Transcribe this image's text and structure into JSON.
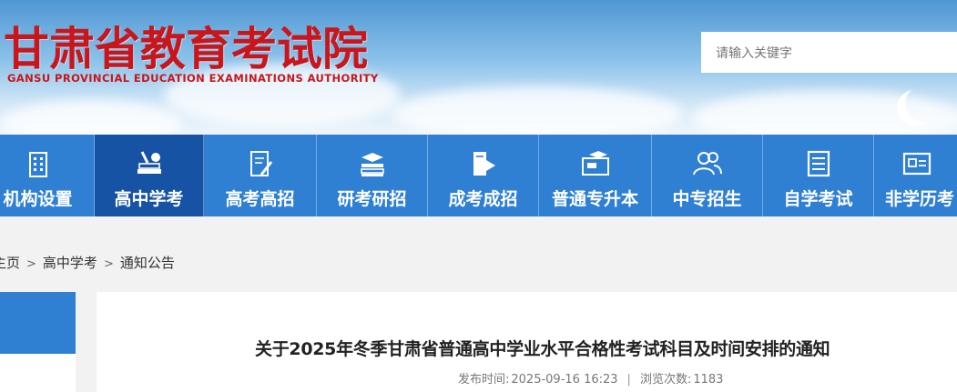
{
  "header": {
    "title_cn": "甘肃省教育考试院",
    "title_en": "GANSU PROVINCIAL EDUCATION EXAMINATIONS AUTHORITY",
    "brand_color": "#c8161d"
  },
  "search": {
    "placeholder": "请输入关键字"
  },
  "nav": {
    "items": [
      {
        "label": "机构设置",
        "icon": "building-icon"
      },
      {
        "label": "高中学考",
        "icon": "books-apple-icon",
        "active": true
      },
      {
        "label": "高考高招",
        "icon": "document-pen-icon"
      },
      {
        "label": "研考研招",
        "icon": "book-stack-icon"
      },
      {
        "label": "成考成招",
        "icon": "book-flag-icon"
      },
      {
        "label": "普通专升本",
        "icon": "graduation-screen-icon"
      },
      {
        "label": "中专招生",
        "icon": "users-icon"
      },
      {
        "label": "自学考试",
        "icon": "document-lines-icon"
      },
      {
        "label": "非学历考",
        "icon": "id-card-icon"
      }
    ],
    "bg_color": "#2f7fd3",
    "active_color": "#1653a4"
  },
  "breadcrumb": {
    "home": "主页",
    "level1": "高中学考",
    "level2": "通知公告",
    "separator": ">"
  },
  "article": {
    "title": "关于2025年冬季甘肃省普通高中学业水平合格性考试科目及时间安排的通知",
    "publish_label": "发布时间:",
    "publish_time": "2025-09-16 16:23",
    "divider": "|",
    "views_label": "浏览次数:",
    "views": "1183"
  }
}
